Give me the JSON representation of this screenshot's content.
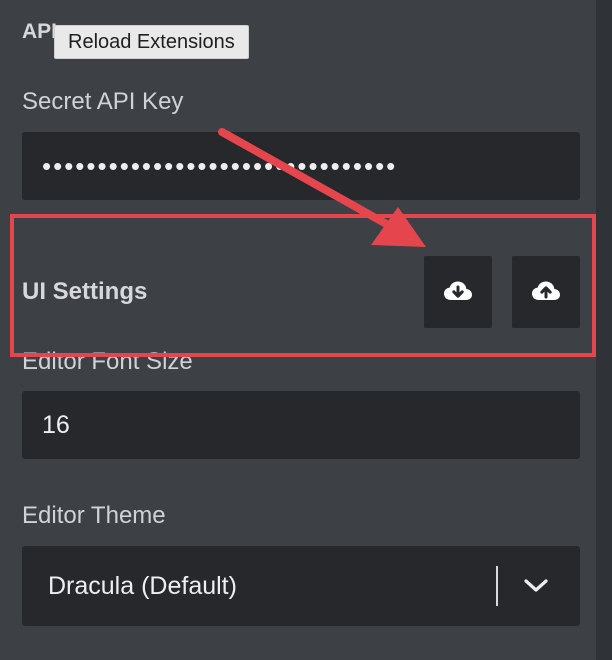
{
  "api_section": {
    "title": "API"
  },
  "tooltip": {
    "text": "Reload Extensions"
  },
  "secret_api_key": {
    "label": "Secret API Key",
    "masked_value": "••••••••••••••••••••••••••••••••"
  },
  "ui_settings": {
    "title": "UI Settings",
    "download_icon": "cloud-download-icon",
    "upload_icon": "cloud-upload-icon"
  },
  "editor_font_size": {
    "label": "Editor Font Size",
    "value": "16"
  },
  "editor_theme": {
    "label": "Editor Theme",
    "selected": "Dracula (Default)"
  },
  "annotation": {
    "color": "#e5454d"
  }
}
